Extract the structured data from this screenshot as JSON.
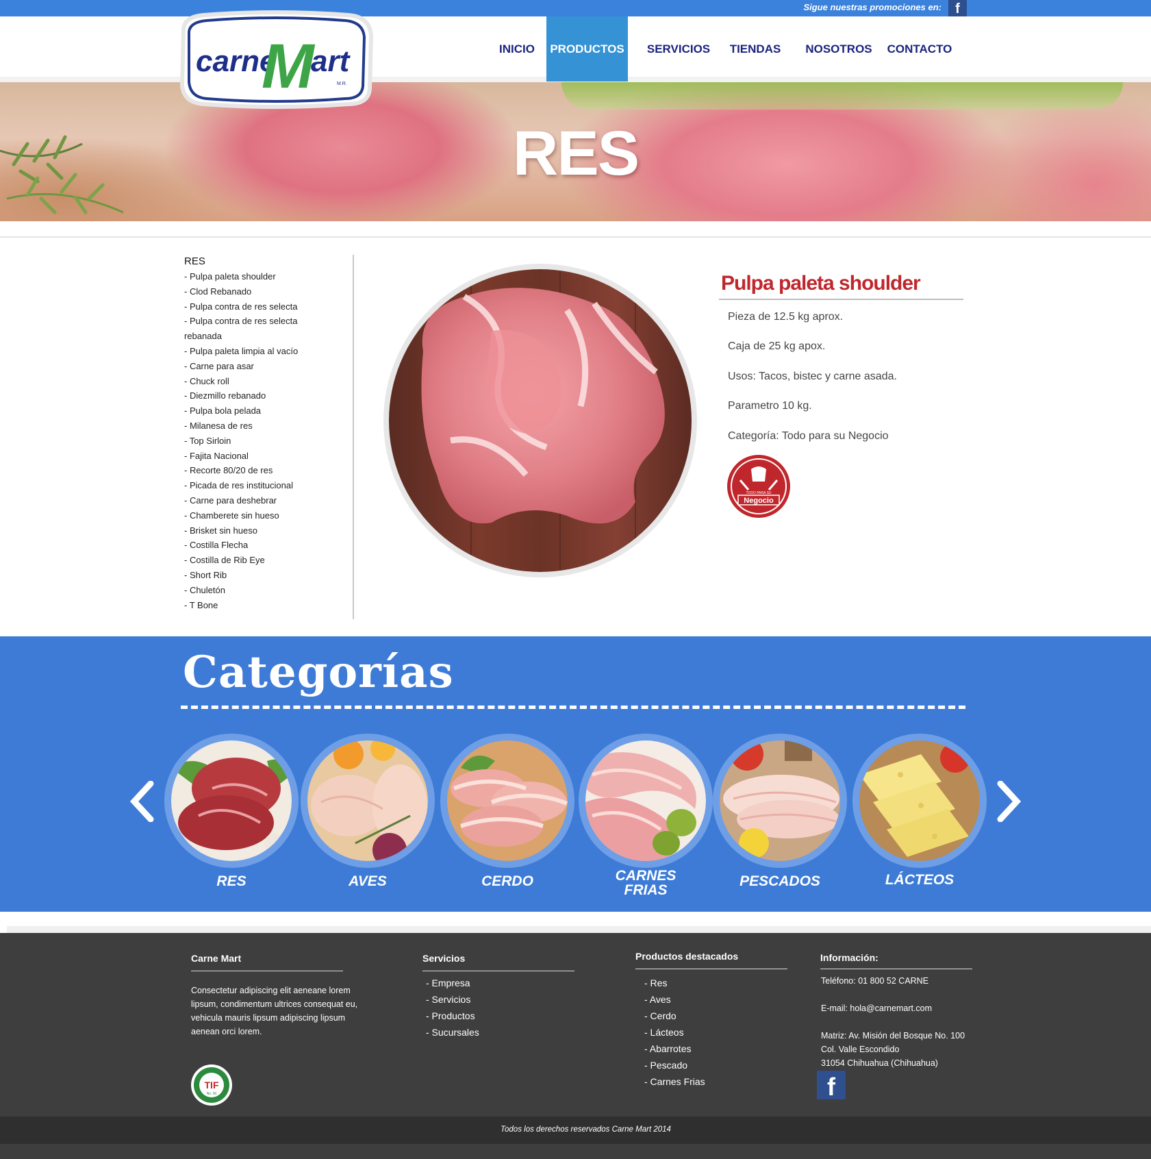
{
  "topbar": {
    "promo_text": "Sigue nuestras promociones en:",
    "facebook_glyph": "f",
    "facebook_icon": "facebook-icon"
  },
  "logo": {
    "text_left": "carne",
    "text_m": "M",
    "text_right": "art",
    "mark": "M.R."
  },
  "nav": {
    "items": [
      {
        "label": "INICIO"
      },
      {
        "label": "PRODUCTOS"
      },
      {
        "label": "SERVICIOS"
      },
      {
        "label": "TIENDAS"
      },
      {
        "label": "NOSOTROS"
      },
      {
        "label": "CONTACTO"
      }
    ]
  },
  "banner": {
    "title": "RES"
  },
  "sidebar": {
    "title": "RES",
    "items": [
      "- Pulpa paleta shoulder",
      "- Clod Rebanado",
      "- Pulpa contra de res selecta",
      "- Pulpa contra de res selecta",
      "rebanada",
      "- Pulpa paleta limpia al vacío",
      "- Carne para asar",
      "- Chuck roll",
      "- Diezmillo rebanado",
      "- Pulpa bola pelada",
      "- Milanesa de res",
      "- Top Sirloin",
      "- Fajita Nacional",
      "- Recorte 80/20 de res",
      "- Picada de res institucional",
      "- Carne para deshebrar",
      "- Chamberete sin hueso",
      "- Brisket sin hueso",
      "- Costilla Flecha",
      "- Costilla de Rib Eye",
      "- Short Rib",
      "- Chuletón",
      "- T Bone"
    ]
  },
  "product": {
    "title": "Pulpa paleta shoulder",
    "lines": [
      "Pieza de 12.5 kg  aprox.",
      "Caja de 25 kg apox.",
      "Usos: Tacos, bistec y carne asada.",
      "Parametro 10 kg.",
      "Categoría: Todo para su Negocio"
    ],
    "badge_text": "Negocio",
    "badge_small": "TODO PARA SU"
  },
  "categories": {
    "title": "Categorías",
    "items": [
      {
        "label": "RES"
      },
      {
        "label": "AVES"
      },
      {
        "label": "CERDO"
      },
      {
        "label": "CARNES",
        "label2": "FRIAS"
      },
      {
        "label": "PESCADOS"
      },
      {
        "label": "LÁCTEOS"
      }
    ],
    "prev_icon": "chevron-left-icon",
    "next_icon": "chevron-right-icon"
  },
  "footer": {
    "col1": {
      "title": "Carne Mart",
      "text": "Consectetur adipiscing elit aeneane lorem lipsum, condimentum ultrices consequat eu, vehicula mauris lipsum adipiscing lipsum aenean orci lorem."
    },
    "col2": {
      "title": "Servicios",
      "links": [
        "- Empresa",
        "- Servicios",
        "- Productos",
        "- Sucursales"
      ]
    },
    "col3": {
      "title": "Productos destacados",
      "links": [
        "- Res",
        "- Aves",
        "- Cerdo",
        "- Lácteos",
        "- Abarrotes",
        "- Pescado",
        "- Carnes Frias"
      ]
    },
    "col4": {
      "title": "Información:",
      "phone": "Teléfono: 01 800 52 CARNE",
      "email": "E-mail: hola@carnemart.com",
      "address1": "Matriz: Av. Misión del Bosque No. 100",
      "address2": "Col. Valle Escondido",
      "address3": "31054 Chihuahua (Chihuahua)"
    },
    "tif_text": "TIF",
    "tif_ring": "INSPECCIONADO Y APROBADO",
    "tif_no": "No. 90",
    "facebook_glyph": "f",
    "copyright": "Todos los derechos reservados Carne Mart 2014"
  },
  "colors": {
    "brand_blue": "#3b82dc",
    "nav_active": "#3592d5",
    "product_red": "#c0272d",
    "category_bg": "#3d7bd6",
    "footer_bg": "#3e3e3e"
  }
}
